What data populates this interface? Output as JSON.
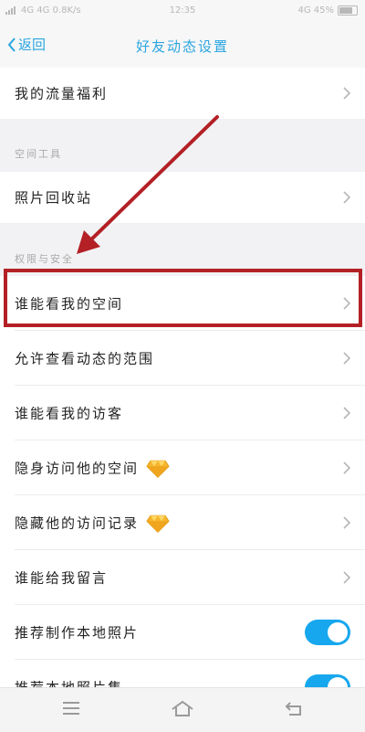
{
  "status_bar": {
    "left_text": "4G 4G 0.8K/s",
    "time": "12:35",
    "right_text": "4G 45%"
  },
  "header": {
    "back_label": "返回",
    "title": "好友动态设置"
  },
  "rows": {
    "traffic": "我的流量福利",
    "recycle": "照片回收站",
    "who_can_see_space": "谁能看我的空间",
    "allow_view_range": "允许查看动态的范围",
    "who_can_see_visitors": "谁能看我的访客",
    "stealth_visit": "隐身访问他的空间",
    "hide_visit_records": "隐藏他的访问记录",
    "who_can_message": "谁能给我留言",
    "recommend_local_photos": "推荐制作本地照片",
    "recommend_local_album": "推荐本地照片集"
  },
  "sections": {
    "space_tools": "空间工具",
    "permissions": "权限与安全"
  },
  "toggles": {
    "recommend_local_photos": "on",
    "recommend_local_album": "on"
  },
  "colors": {
    "accent": "#2aa5e0",
    "toggle_on": "#16a7ee",
    "highlight": "#b32025"
  },
  "icons": {
    "back": "chevron-left-icon",
    "row_chevron": "chevron-right-icon",
    "vip": "diamond-icon",
    "menu": "menu-icon",
    "home": "home-icon",
    "back_nav": "back-arrow-icon"
  }
}
